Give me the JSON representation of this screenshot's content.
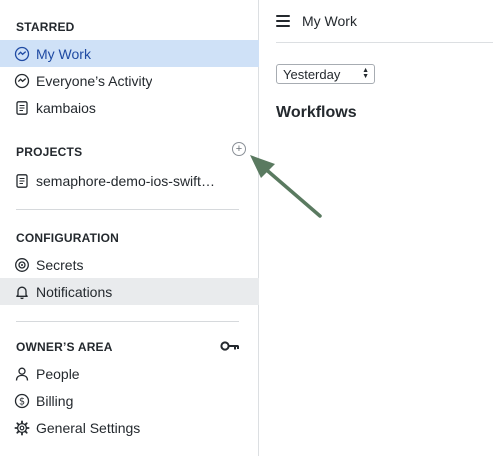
{
  "sidebar": {
    "starred": {
      "title": "STARRED",
      "items": [
        {
          "label": "My Work",
          "icon": "my-work-icon"
        },
        {
          "label": "Everyone’s Activity",
          "icon": "activity-icon"
        },
        {
          "label": "kambaios",
          "icon": "document-icon"
        }
      ]
    },
    "projects": {
      "title": "PROJECTS",
      "add_icon": "plus-circle-icon",
      "items": [
        {
          "label": "semaphore-demo-ios-swift…",
          "icon": "document-icon"
        }
      ]
    },
    "configuration": {
      "title": "CONFIGURATION",
      "items": [
        {
          "label": "Secrets",
          "icon": "secrets-icon"
        },
        {
          "label": "Notifications",
          "icon": "bell-icon"
        }
      ]
    },
    "owners_area": {
      "title": "OWNER’S AREA",
      "key_icon": "key-icon",
      "items": [
        {
          "label": "People",
          "icon": "person-icon"
        },
        {
          "label": "Billing",
          "icon": "dollar-icon"
        },
        {
          "label": "General Settings",
          "icon": "gear-icon"
        }
      ]
    }
  },
  "main": {
    "title": "My Work",
    "date_filter": {
      "selected": "Yesterday"
    },
    "workflows_heading": "Workflows"
  },
  "colors": {
    "active_bg": "#cfe1f7",
    "active_text": "#1f4aa3",
    "hover_bg": "#e9ebed",
    "annotation_arrow": "#5a7a60"
  }
}
